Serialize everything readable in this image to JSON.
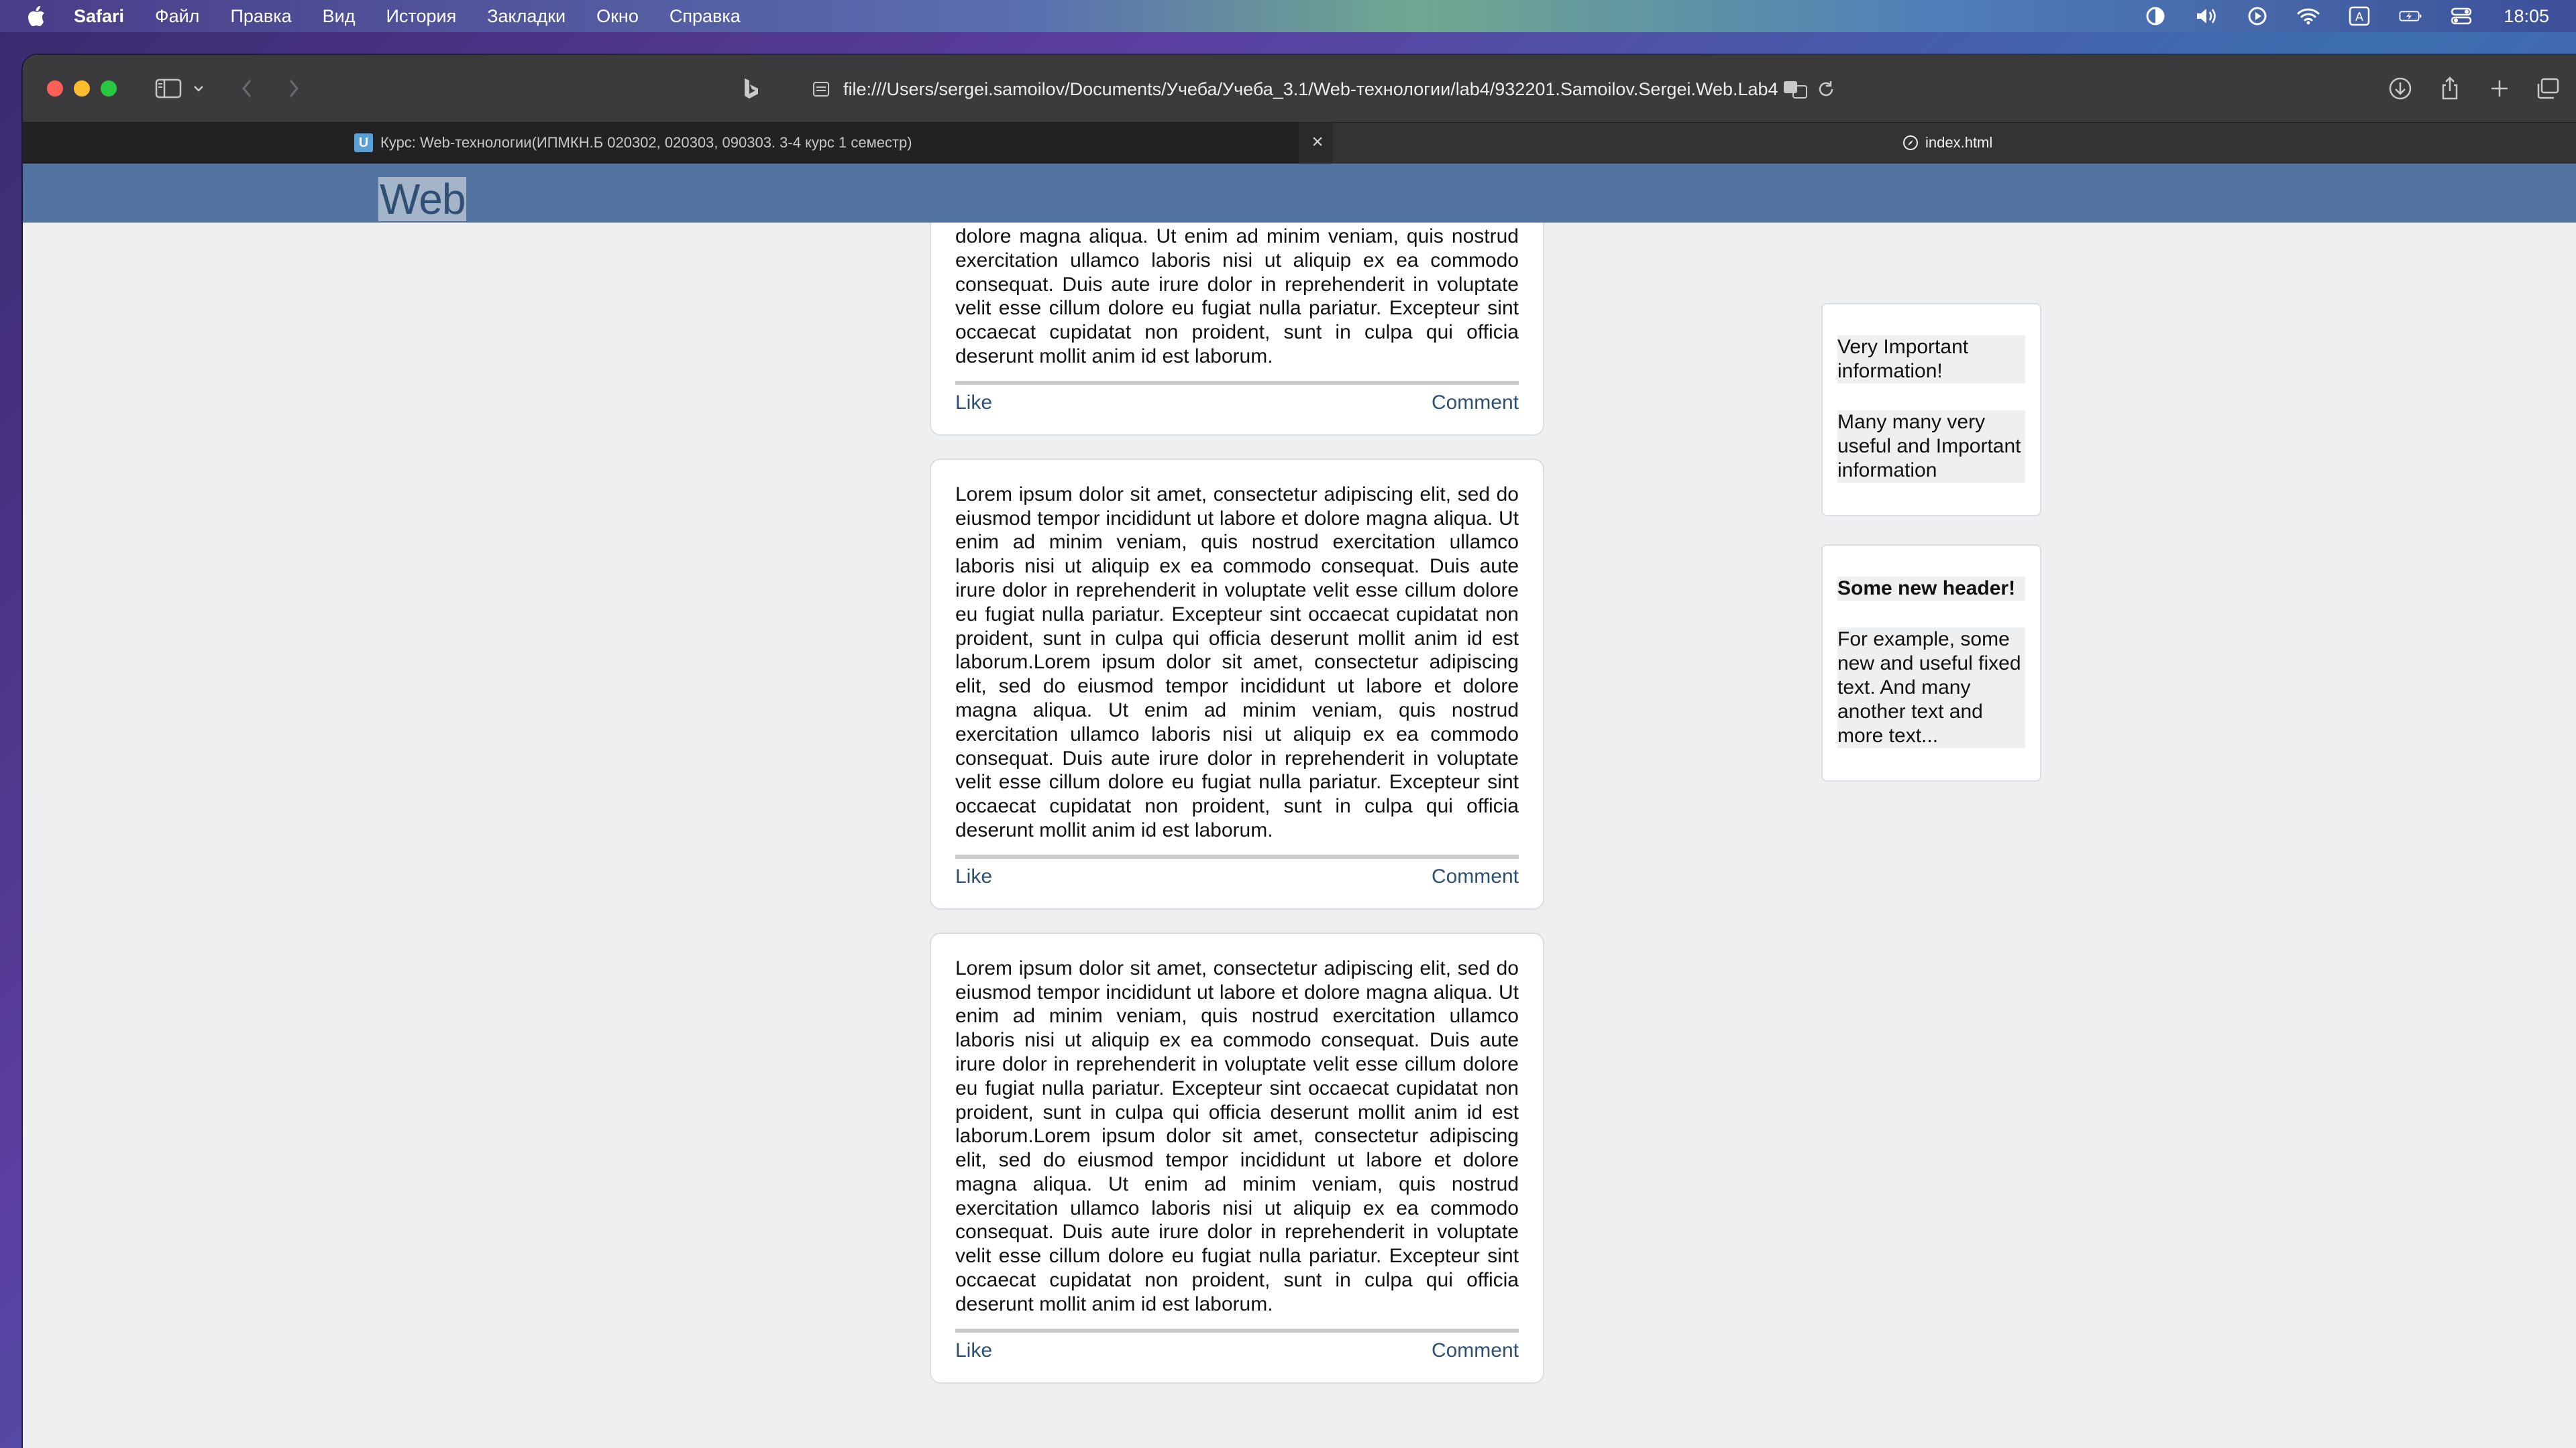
{
  "menubar": {
    "app": "Safari",
    "items": [
      "Файл",
      "Правка",
      "Вид",
      "История",
      "Закладки",
      "Окно",
      "Справка"
    ],
    "clock": "18:05",
    "input_indicator": "A"
  },
  "browser": {
    "url": "file:///Users/sergei.samoilov/Documents/Учеба/Учеба_3.1/Web-технологии/lab4/932201.Samoilov.Sergei.Web.Lab4",
    "tabs": [
      {
        "favicon": "U",
        "title": "Курс: Web-технологии(ИПМКН.Б 020302, 020303, 090303. 3-4 курс 1 семестр)"
      },
      {
        "title": "index.html"
      }
    ]
  },
  "site": {
    "logo": "Web",
    "posts": [
      {
        "text": "Duis aute irure dolor in reprehenderit in voluptate velit esse cillum dolore eu fugiat nulla pariatur. Excepteur sint occaecat cupidatat non proident, sunt in culpa qui officia deserunt mollit anim id est laborum.Lorem ipsum dolor sit amet, consectetur adipiscing elit, sed do eiusmod tempor incididunt ut labore et dolore magna aliqua. Ut enim ad minim veniam, quis nostrud exercitation ullamco laboris nisi ut aliquip ex ea commodo consequat. Duis aute irure dolor in reprehenderit in voluptate velit esse cillum dolore eu fugiat nulla pariatur. Excepteur sint occaecat cupidatat non proident, sunt in culpa qui officia deserunt mollit anim id est laborum.",
        "like": "Like",
        "comment": "Comment"
      },
      {
        "text": "Lorem ipsum dolor sit amet, consectetur adipiscing elit, sed do eiusmod tempor incididunt ut labore et dolore magna aliqua. Ut enim ad minim veniam, quis nostrud exercitation ullamco laboris nisi ut aliquip ex ea commodo consequat. Duis aute irure dolor in reprehenderit in voluptate velit esse cillum dolore eu fugiat nulla pariatur. Excepteur sint occaecat cupidatat non proident, sunt in culpa qui officia deserunt mollit anim id est laborum.Lorem ipsum dolor sit amet, consectetur adipiscing elit, sed do eiusmod tempor incididunt ut labore et dolore magna aliqua. Ut enim ad minim veniam, quis nostrud exercitation ullamco laboris nisi ut aliquip ex ea commodo consequat. Duis aute irure dolor in reprehenderit in voluptate velit esse cillum dolore eu fugiat nulla pariatur. Excepteur sint occaecat cupidatat non proident, sunt in culpa qui officia deserunt mollit anim id est laborum.",
        "like": "Like",
        "comment": "Comment"
      },
      {
        "text": "Lorem ipsum dolor sit amet, consectetur adipiscing elit, sed do eiusmod tempor incididunt ut labore et dolore magna aliqua. Ut enim ad minim veniam, quis nostrud exercitation ullamco laboris nisi ut aliquip ex ea commodo consequat. Duis aute irure dolor in reprehenderit in voluptate velit esse cillum dolore eu fugiat nulla pariatur. Excepteur sint occaecat cupidatat non proident, sunt in culpa qui officia deserunt mollit anim id est laborum.Lorem ipsum dolor sit amet, consectetur adipiscing elit, sed do eiusmod tempor incididunt ut labore et dolore magna aliqua. Ut enim ad minim veniam, quis nostrud exercitation ullamco laboris nisi ut aliquip ex ea commodo consequat. Duis aute irure dolor in reprehenderit in voluptate velit esse cillum dolore eu fugiat nulla pariatur. Excepteur sint occaecat cupidatat non proident, sunt in culpa qui officia deserunt mollit anim id est laborum.",
        "like": "Like",
        "comment": "Comment"
      }
    ],
    "sidebar": {
      "card1": {
        "line1": "Very Important information!",
        "line2": "Many many very useful and Important information"
      },
      "card2": {
        "header": "Some new header!",
        "body": "For example, some new and useful fixed text. And many another text and more text..."
      }
    }
  }
}
